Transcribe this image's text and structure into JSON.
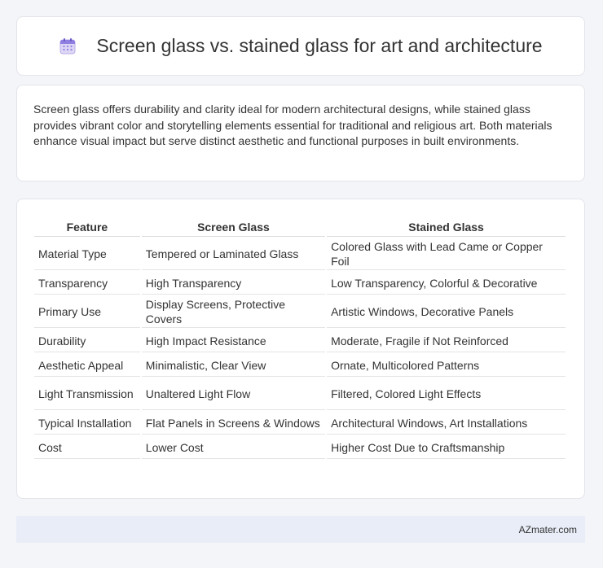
{
  "header": {
    "title": "Screen glass vs. stained glass for art and architecture",
    "icon": "calendar-icon"
  },
  "summary": {
    "text": "Screen glass offers durability and clarity ideal for modern architectural designs, while stained glass provides vibrant color and storytelling elements essential for traditional and religious art. Both materials enhance visual impact but serve distinct aesthetic and functional purposes in built environments."
  },
  "table": {
    "headers": [
      "Feature",
      "Screen Glass",
      "Stained Glass"
    ],
    "rows": [
      [
        "Material Type",
        "Tempered or Laminated Glass",
        "Colored Glass with Lead Came or Copper Foil"
      ],
      [
        "Transparency",
        "High Transparency",
        "Low Transparency, Colorful & Decorative"
      ],
      [
        "Primary Use",
        "Display Screens, Protective Covers",
        "Artistic Windows, Decorative Panels"
      ],
      [
        "Durability",
        "High Impact Resistance",
        "Moderate, Fragile if Not Reinforced"
      ],
      [
        "Aesthetic Appeal",
        "Minimalistic, Clear View",
        "Ornate, Multicolored Patterns"
      ],
      [
        "Light Transmission",
        "Unaltered Light Flow",
        "Filtered, Colored Light Effects"
      ],
      [
        "Typical Installation",
        "Flat Panels in Screens & Windows",
        "Architectural Windows, Art Installations"
      ],
      [
        "Cost",
        "Lower Cost",
        "Higher Cost Due to Craftsmanship"
      ]
    ]
  },
  "footer": {
    "text": "AZmater.com"
  }
}
